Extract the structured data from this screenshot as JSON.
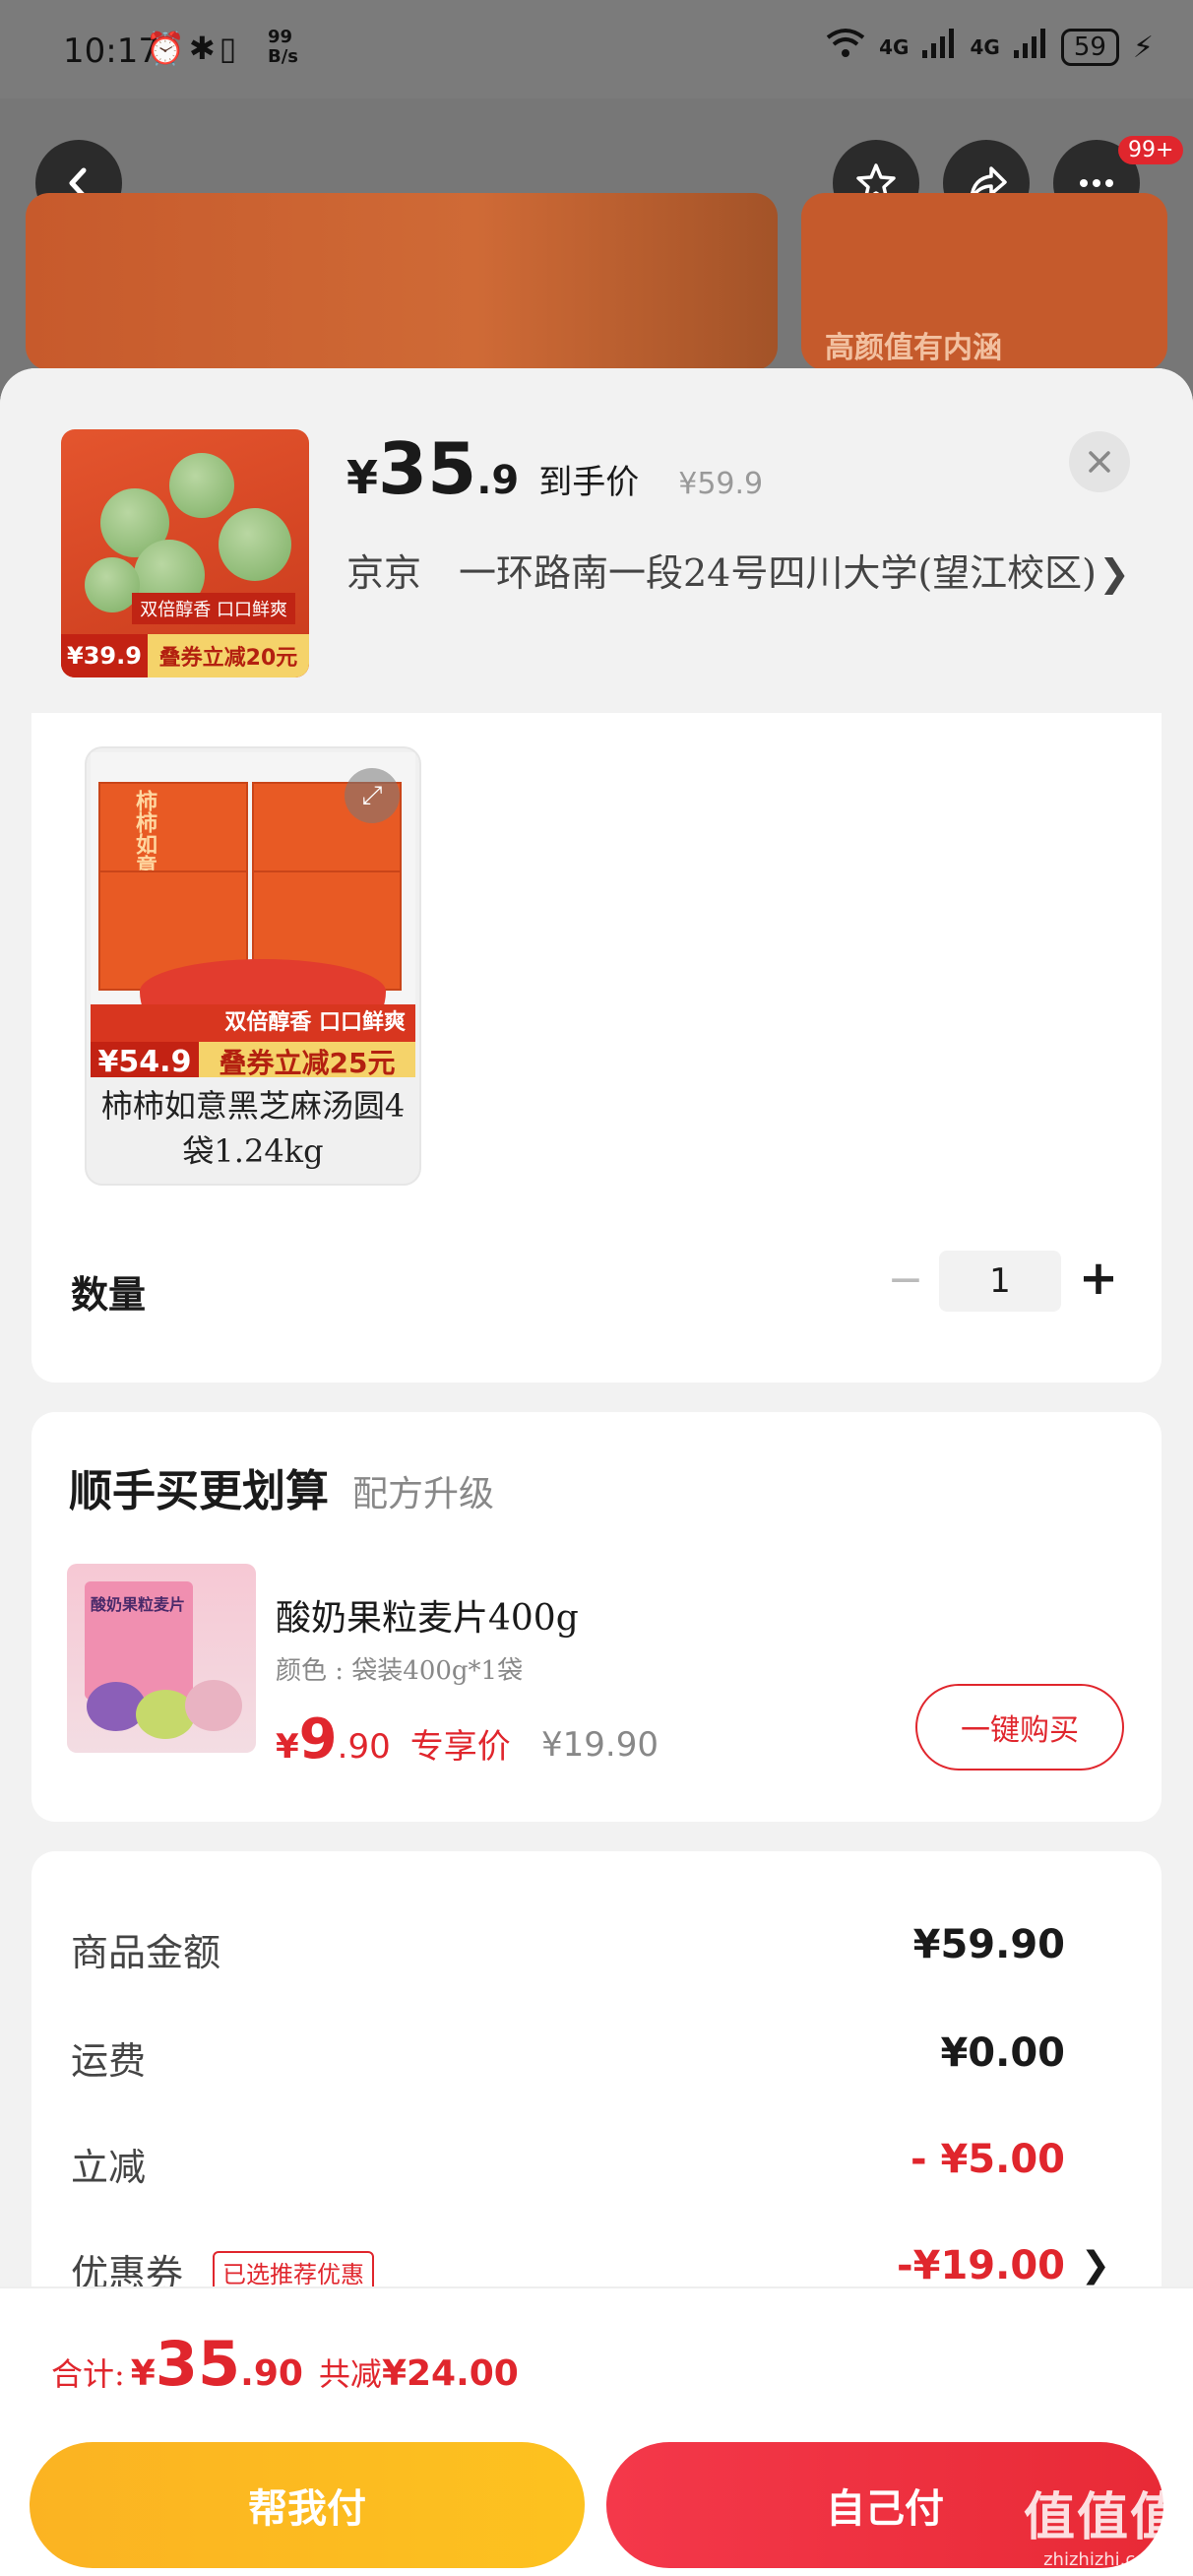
{
  "status_bar": {
    "time": "10:17",
    "speed_value": "99",
    "speed_unit": "B/s",
    "network_1": "4G",
    "network_2": "4G",
    "battery": "59"
  },
  "header": {
    "more_badge": "99+",
    "banner_text": "高颜值有内涵"
  },
  "product": {
    "thumb_tag": "双倍醇香 口口鲜爽",
    "thumb_price": "¥39.9",
    "thumb_deal": "叠券立减20元",
    "price_symbol": "¥",
    "price_int": "35",
    "price_dec": ".9",
    "price_label": "到手价",
    "original_price": "¥59.9",
    "address": "京京　一环路南一段24号四川大学(望江校区)"
  },
  "spec": {
    "item": {
      "pkg_label": "柿柿如意",
      "strip_text": "双倍醇香 口口鲜爽",
      "price_badge": "¥54.9",
      "deal_badge": "叠券立减25元",
      "name": "柿柿如意黑芝麻汤圆4袋1.24kg"
    },
    "quantity_label": "数量",
    "quantity_value": "1"
  },
  "combo": {
    "title": "顺手买更划算",
    "subtitle": "配方升级",
    "product_name": "酸奶果粒麦片400g",
    "color_label": "颜色 : 袋装400g*1袋",
    "img_label": "酸奶果粒麦片",
    "price_symbol": "¥",
    "price_int": "9",
    "price_dec": ".90",
    "price_label": "专享价",
    "original_price": "¥19.90",
    "buy_button": "一键购买"
  },
  "summary": {
    "rows": [
      {
        "label": "商品金额",
        "value": "¥59.90"
      },
      {
        "label": "运费",
        "value": "¥0.00"
      },
      {
        "label": "立减",
        "value": "- ¥5.00"
      },
      {
        "label": "优惠券",
        "value": "-¥19.00",
        "tag": "已选推荐优惠"
      }
    ]
  },
  "footer": {
    "total_label": "合计:",
    "total_symbol": "¥",
    "total_int": "35",
    "total_dec": ".90",
    "save_label": "共减",
    "save_value": "¥24.00",
    "help_pay": "帮我付",
    "self_pay": "自己付",
    "watermark_main": "值值值",
    "watermark_sub": "zhizhizhi.com"
  },
  "colors": {
    "accent_red": "#e0262d",
    "pay_yellow": "#fbb322",
    "pay_red": "#f4384a"
  }
}
